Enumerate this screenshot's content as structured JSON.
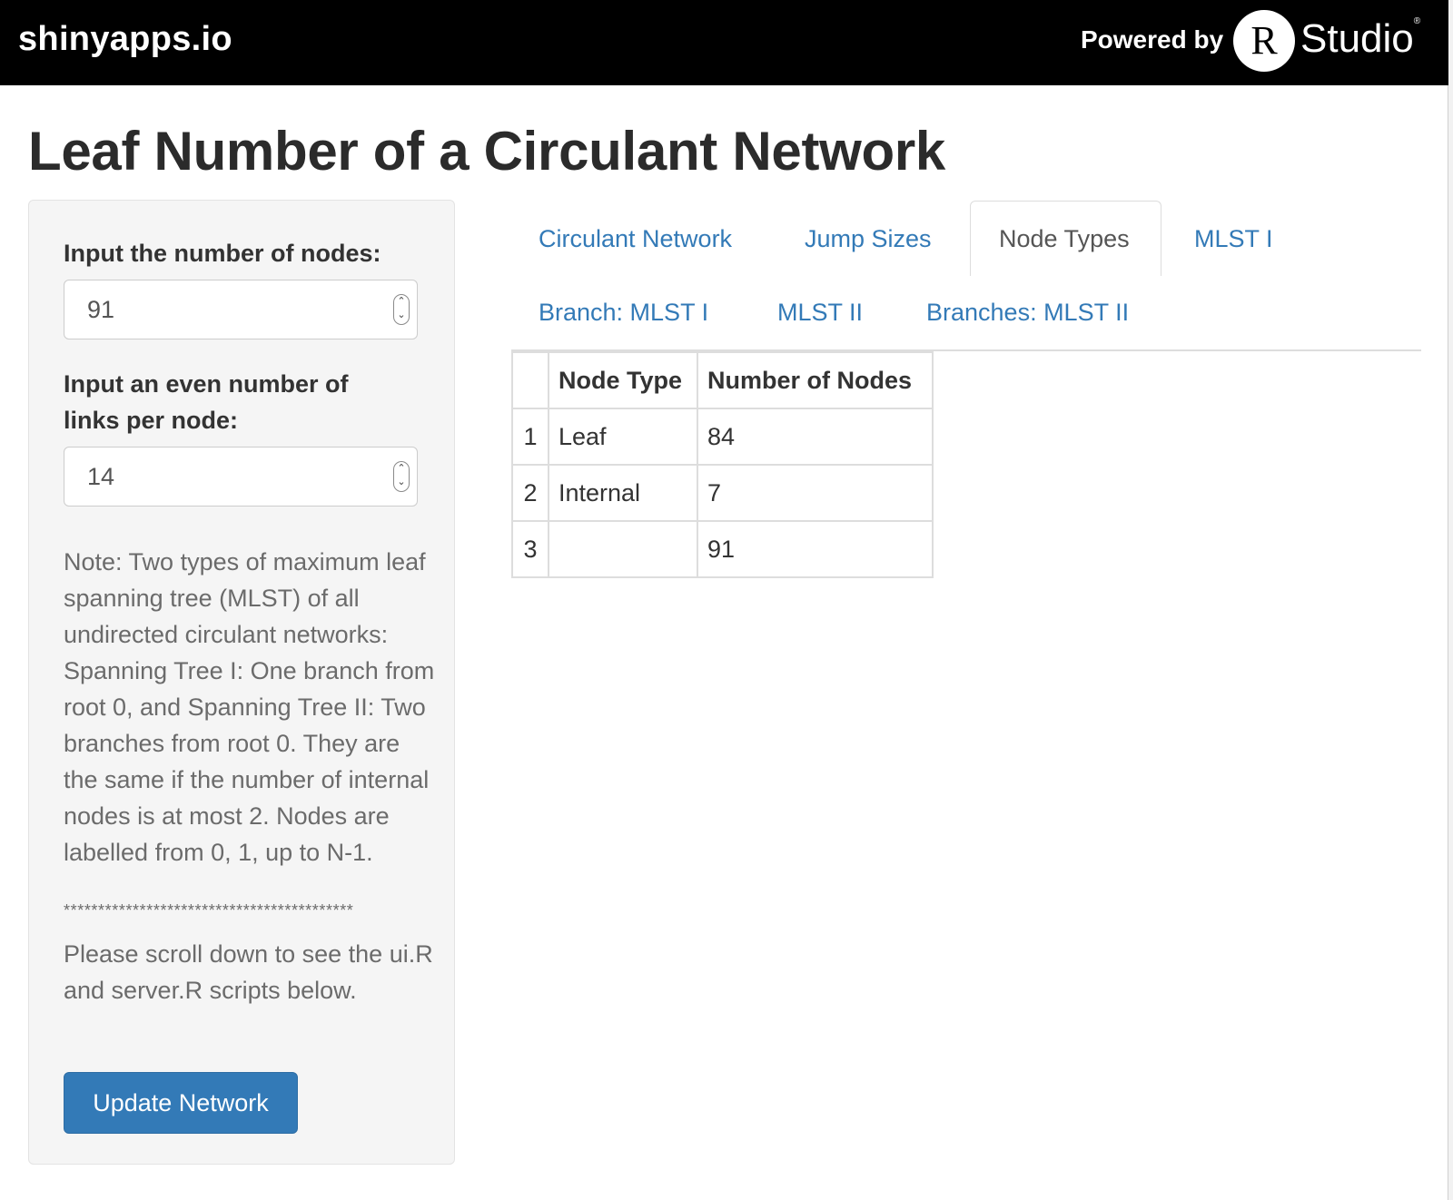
{
  "header": {
    "brand": "shinyapps.io",
    "powered_by": "Powered by",
    "rstudio_r": "R",
    "rstudio_text": "Studio",
    "rstudio_reg": "®"
  },
  "page": {
    "title": "Leaf Number of a Circulant Network"
  },
  "sidebar": {
    "nodes_label": "Input the number of nodes:",
    "nodes_value": "91",
    "links_label": "Input an even number of links per node:",
    "links_value": "14",
    "note": "Note: Two types of maximum leaf spanning tree (MLST) of all undirected circulant networks: Spanning Tree I: One branch from root 0, and Spanning Tree II: Two branches from root 0. They are the same if the number of internal nodes is at most 2. Nodes are labelled from 0, 1, up to N-1.",
    "stars": "******************************************",
    "scroll_note": "Please scroll down to see the ui.R and server.R scripts below.",
    "button_label": "Update Network"
  },
  "tabs": [
    {
      "label": "Circulant Network",
      "active": false
    },
    {
      "label": "Jump Sizes",
      "active": false
    },
    {
      "label": "Node Types",
      "active": true
    },
    {
      "label": "MLST I",
      "active": false
    },
    {
      "label": "Branch: MLST I",
      "active": false
    },
    {
      "label": "MLST II",
      "active": false
    },
    {
      "label": "Branches: MLST II",
      "active": false
    }
  ],
  "table": {
    "headers": [
      "",
      "Node Type",
      "Number of Nodes"
    ],
    "rows": [
      {
        "index": "1",
        "node_type": "Leaf",
        "count": "84"
      },
      {
        "index": "2",
        "node_type": "Internal",
        "count": "7"
      },
      {
        "index": "3",
        "node_type": "",
        "count": "91"
      }
    ]
  },
  "colors": {
    "link": "#337ab7",
    "button": "#337ab7",
    "header_bg": "#000000"
  }
}
